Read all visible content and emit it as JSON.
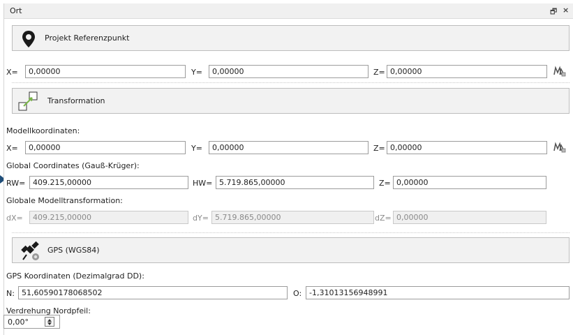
{
  "window": {
    "title": "Ort",
    "float_icon": "float-icon",
    "close_glyph": "×",
    "float_glyph": "🗗"
  },
  "project_ref": {
    "title": "Projekt Referenzpunkt",
    "icon": "map-pin-icon",
    "x_label": "X=",
    "x_value": "0,00000",
    "y_label": "Y=",
    "y_value": "0,00000",
    "z_label": "Z=",
    "z_value": "0,00000"
  },
  "transformation": {
    "title": "Transformation",
    "icon": "transform-icon",
    "model_coords_label": "Modellkoordinaten:",
    "x_label": "X=",
    "x_value": "0,00000",
    "y_label": "Y=",
    "y_value": "0,00000",
    "z_label": "Z=",
    "z_value": "0,00000",
    "global_label": "Global Coordinates (Gauß-Krüger):",
    "rw_label": "RW=",
    "rw_value": "409.215,00000",
    "hw_label": "HW=",
    "hw_value": "5.719.865,00000",
    "gz_label": "Z=",
    "gz_value": "0,00000",
    "global_model_label": "Globale Modelltransformation:",
    "dx_label": "dX=",
    "dx_value": "409.215,00000",
    "dy_label": "dY=",
    "dy_value": "5.719.865,00000",
    "dz_label": "dZ=",
    "dz_value": "0,00000"
  },
  "gps": {
    "title": "GPS (WGS84)",
    "icon": "satellite-icon",
    "coords_label": "GPS Koordinaten (Dezimalgrad DD):",
    "n_label": "N:",
    "n_value": "51,60590178068502",
    "o_label": "O:",
    "o_value": "-1,31013156948991",
    "north_label": "Verdrehung Nordpfeil:",
    "north_value": "0,00°"
  }
}
